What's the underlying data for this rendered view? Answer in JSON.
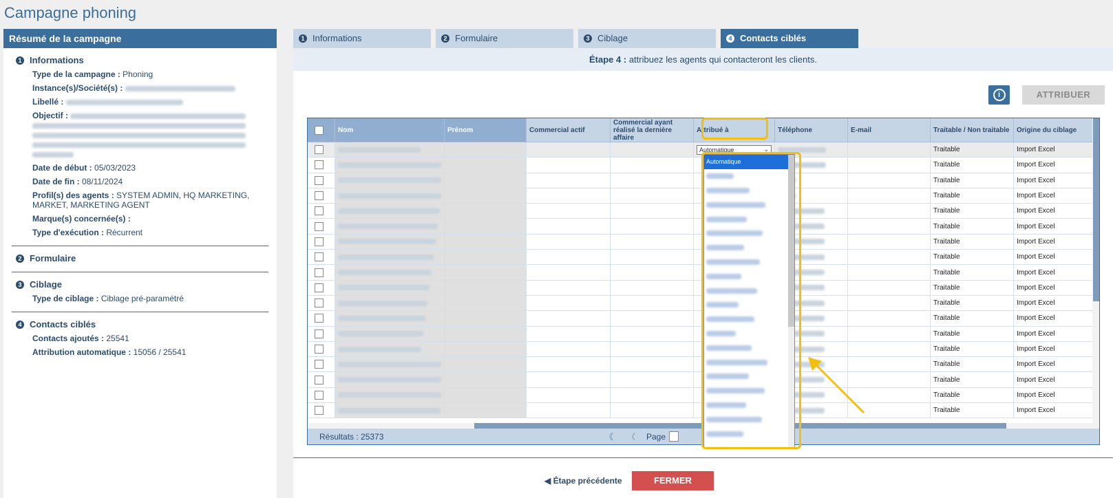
{
  "page_title": "Campagne phoning",
  "summary": {
    "header": "Résumé de la campagne",
    "informations": {
      "num": "1",
      "title": "Informations",
      "type_label": "Type de la campagne :",
      "type_value": "Phoning",
      "instance_label": "Instance(s)/Société(s) :",
      "libelle_label": "Libellé :",
      "objectif_label": "Objectif :",
      "date_debut_label": "Date de début :",
      "date_debut_value": "05/03/2023",
      "date_fin_label": "Date de fin :",
      "date_fin_value": "08/11/2024",
      "profils_label": "Profil(s) des agents :",
      "profils_value": "SYSTEM ADMIN, HQ MARKETING, MARKET, MARKETING AGENT",
      "marques_label": "Marque(s) concernée(s) :",
      "execution_label": "Type d'exécution :",
      "execution_value": "Récurrent"
    },
    "formulaire": {
      "num": "2",
      "title": "Formulaire"
    },
    "ciblage": {
      "num": "3",
      "title": "Ciblage",
      "type_label": "Type de ciblage :",
      "type_value": "Ciblage pré-paramétré"
    },
    "contacts": {
      "num": "4",
      "title": "Contacts ciblés",
      "ajoutes_label": "Contacts ajoutés :",
      "ajoutes_value": "25541",
      "auto_label": "Attribution automatique :",
      "auto_value": "15056 / 25541"
    }
  },
  "tabs": [
    {
      "num": "1",
      "label": "Informations"
    },
    {
      "num": "2",
      "label": "Formulaire"
    },
    {
      "num": "3",
      "label": "Ciblage"
    },
    {
      "num": "4",
      "label": "Contacts ciblés"
    }
  ],
  "step": {
    "prefix": "Étape 4 :",
    "text": " attribuez les agents qui contacteront les clients."
  },
  "toolbar": {
    "info_glyph": "i",
    "attribuer_label": "ATTRIBUER"
  },
  "table": {
    "columns": [
      "Nom",
      "Prénom",
      "Commercial actif",
      "Commercial ayant réalisé la dernière affaire",
      "Attribué à",
      "Téléphone",
      "E-mail",
      "Traitable / Non traitable",
      "Origine du ciblage"
    ],
    "rows": [
      {
        "traitable": "Traitable",
        "origine": "Import Excel"
      },
      {
        "traitable": "Traitable",
        "origine": "Import Excel"
      },
      {
        "traitable": "Traitable",
        "origine": "Import Excel"
      },
      {
        "traitable": "Traitable",
        "origine": "Import Excel"
      },
      {
        "traitable": "Traitable",
        "origine": "Import Excel"
      },
      {
        "traitable": "Traitable",
        "origine": "Import Excel"
      },
      {
        "traitable": "Traitable",
        "origine": "Import Excel"
      },
      {
        "traitable": "Traitable",
        "origine": "Import Excel"
      },
      {
        "traitable": "Traitable",
        "origine": "Import Excel"
      },
      {
        "traitable": "Traitable",
        "origine": "Import Excel"
      },
      {
        "traitable": "Traitable",
        "origine": "Import Excel"
      },
      {
        "traitable": "Traitable",
        "origine": "Import Excel"
      },
      {
        "traitable": "Traitable",
        "origine": "Import Excel"
      },
      {
        "traitable": "Traitable",
        "origine": "Import Excel"
      },
      {
        "traitable": "Traitable",
        "origine": "Import Excel"
      },
      {
        "traitable": "Traitable",
        "origine": "Import Excel"
      },
      {
        "traitable": "Traitable",
        "origine": "Import Excel"
      },
      {
        "traitable": "Traitable",
        "origine": "Import Excel"
      }
    ],
    "attribue_select_value": "Automatique",
    "results_label": "Résultats : 25373",
    "page_label": "Page",
    "first_glyph": "《",
    "prev_glyph": "〈"
  },
  "dropdown": {
    "selected": "Automatique",
    "blurred_option_count": 19
  },
  "footer": {
    "prev_label": "Étape précédente",
    "close_label": "FERMER"
  },
  "colors": {
    "primary": "#3a6e9c",
    "tab_inactive": "#c5d5e6",
    "close_button": "#d4504e",
    "highlight": "#f3bf0f",
    "dropdown_selected": "#1e6fd9"
  }
}
